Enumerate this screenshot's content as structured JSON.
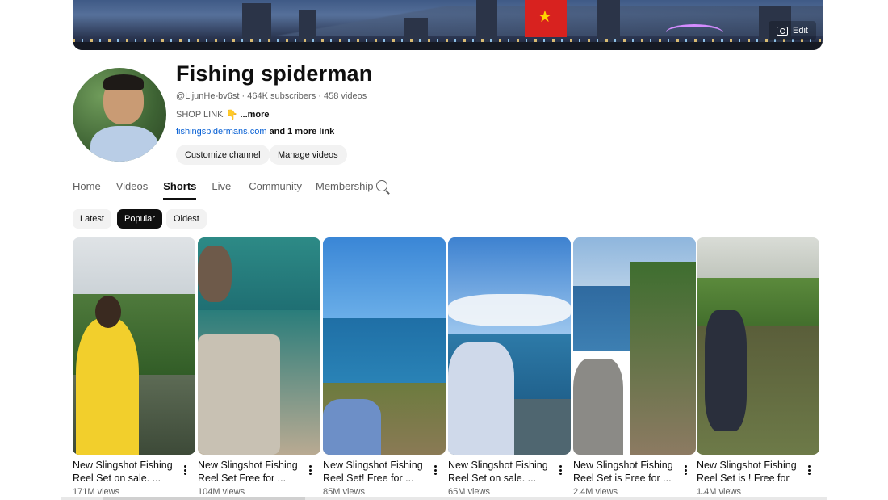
{
  "banner": {
    "edit_label": "Edit"
  },
  "channel": {
    "name": "Fishing spiderman",
    "handle": "@LijunHe-bv6st",
    "subscribers": "464K subscribers",
    "videos": "458 videos",
    "description_prefix": "SHOP LINK",
    "description_more": "...more",
    "link": "fishingspidermans.com",
    "more_links": "and 1 more link"
  },
  "actions": {
    "customize": "Customize channel",
    "manage": "Manage videos"
  },
  "tabs": [
    "Home",
    "Videos",
    "Shorts",
    "Live",
    "Community",
    "Membership"
  ],
  "active_tab": "Shorts",
  "chips": [
    "Latest",
    "Popular",
    "Oldest"
  ],
  "active_chip": "Popular",
  "shorts": [
    {
      "title": "New Slingshot Fishing Reel Set on sale. ...",
      "views": "171M views"
    },
    {
      "title": "New Slingshot Fishing Reel Set Free for ...",
      "views": "104M views"
    },
    {
      "title": "New Slingshot Fishing Reel Set! Free for ...",
      "views": "85M views"
    },
    {
      "title": "New Slingshot Fishing Reel Set on sale. ...",
      "views": "65M views"
    },
    {
      "title": "New Slingshot Fishing Reel Set is Free for ...",
      "views": "2.4M views"
    },
    {
      "title": "New Slingshot Fishing Reel Set is ! Free for ...",
      "views": "1.4M views"
    }
  ],
  "colors": {
    "link": "#065fd4",
    "text": "#0f0f0f",
    "muted": "#606060",
    "chip_bg": "#f2f2f2"
  },
  "icons": {
    "camera": "camera-icon",
    "search": "search-icon",
    "more": "more-vert-icon"
  }
}
